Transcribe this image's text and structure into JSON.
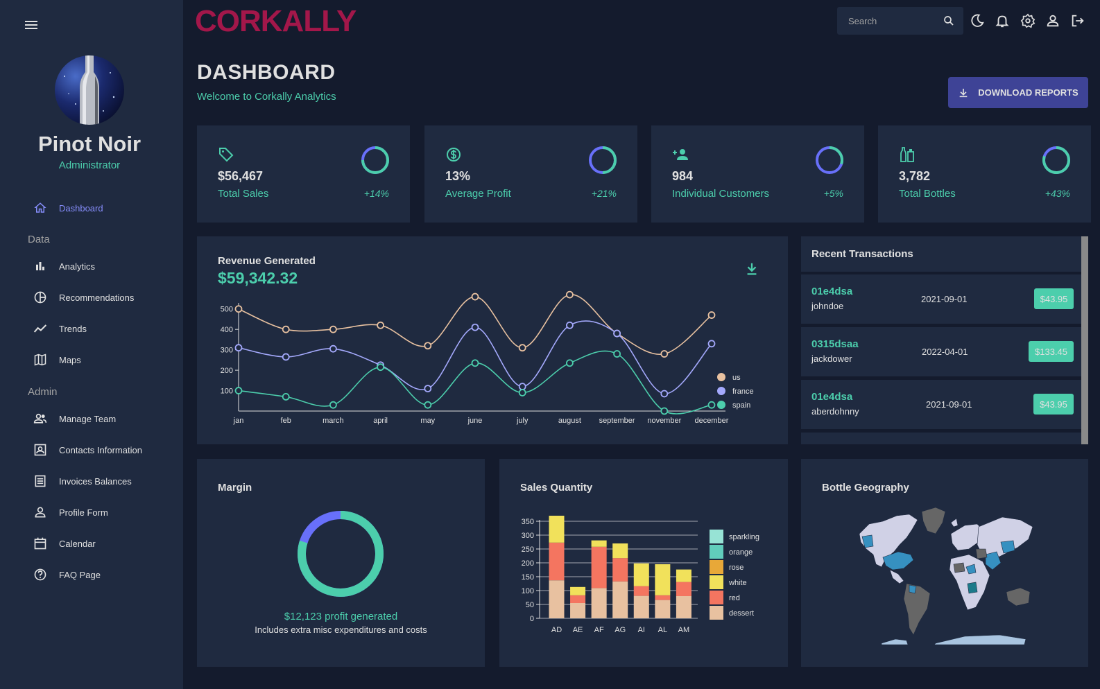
{
  "app": {
    "logo": "CORKALLY"
  },
  "sidebar": {
    "user_name": "Pinot Noir",
    "user_role": "Administrator",
    "items": [
      {
        "label": "Dashboard",
        "icon": "home-icon",
        "active": true
      },
      {
        "label": "Analytics",
        "icon": "bar-chart-icon"
      },
      {
        "label": "Recommendations",
        "icon": "pie-chart-icon"
      },
      {
        "label": "Trends",
        "icon": "timeline-icon"
      },
      {
        "label": "Maps",
        "icon": "map-icon"
      },
      {
        "label": "Manage Team",
        "icon": "people-icon"
      },
      {
        "label": "Contacts Information",
        "icon": "contacts-icon"
      },
      {
        "label": "Invoices Balances",
        "icon": "receipt-icon"
      },
      {
        "label": "Profile Form",
        "icon": "person-icon"
      },
      {
        "label": "Calendar",
        "icon": "calendar-icon"
      },
      {
        "label": "FAQ Page",
        "icon": "help-icon"
      }
    ],
    "sections": {
      "data": "Data",
      "admin": "Admin"
    }
  },
  "topbar": {
    "search_placeholder": "Search"
  },
  "header": {
    "title": "DASHBOARD",
    "subtitle": "Welcome to Corkally Analytics",
    "download_label": "DOWNLOAD REPORTS"
  },
  "stats": [
    {
      "value": "$56,467",
      "label": "Total Sales",
      "increase": "+14%",
      "progress": 0.75,
      "icon": "tag-icon"
    },
    {
      "value": "13%",
      "label": "Average Profit",
      "increase": "+21%",
      "progress": 0.5,
      "icon": "dollar-icon"
    },
    {
      "value": "984",
      "label": "Individual Customers",
      "increase": "+5%",
      "progress": 0.3,
      "icon": "person-add-icon"
    },
    {
      "value": "3,782",
      "label": "Total Bottles",
      "increase": "+43%",
      "progress": 0.8,
      "icon": "bottles-icon"
    }
  ],
  "revenue": {
    "title": "Revenue Generated",
    "value": "$59,342.32"
  },
  "transactions": {
    "title": "Recent Transactions",
    "rows": [
      {
        "id": "01e4dsa",
        "user": "johndoe",
        "date": "2021-09-01",
        "cost": "$43.95"
      },
      {
        "id": "0315dsaa",
        "user": "jackdower",
        "date": "2022-04-01",
        "cost": "$133.45"
      },
      {
        "id": "01e4dsa",
        "user": "aberdohnny",
        "date": "2021-09-01",
        "cost": "$43.95"
      }
    ]
  },
  "margin": {
    "title": "Margin",
    "profit_text": "$12,123 profit generated",
    "note": "Includes extra misc expenditures and costs",
    "progress": 0.8
  },
  "sales_quantity": {
    "title": "Sales Quantity"
  },
  "geography": {
    "title": "Bottle Geography"
  },
  "colors": {
    "accent_green": "#4cceac",
    "accent_blue": "#6870fa",
    "primary_bg": "#141b2d",
    "card_bg": "#1f2a40",
    "brand": "#a3174a",
    "button": "#3e4396"
  },
  "chart_data": [
    {
      "type": "line",
      "x": [
        "jan",
        "feb",
        "march",
        "april",
        "may",
        "june",
        "july",
        "august",
        "september",
        "november",
        "december"
      ],
      "ylim": [
        0,
        550
      ],
      "yticks": [
        100,
        200,
        300,
        400,
        500
      ],
      "series": [
        {
          "name": "us",
          "color": "#e8c1a0",
          "values": [
            500,
            400,
            400,
            420,
            320,
            560,
            310,
            570,
            380,
            280,
            470
          ]
        },
        {
          "name": "france",
          "color": "#a4a9fc",
          "values": [
            310,
            265,
            305,
            225,
            110,
            410,
            120,
            420,
            380,
            85,
            330
          ]
        },
        {
          "name": "spain",
          "color": "#4cceac",
          "values": [
            100,
            70,
            30,
            215,
            30,
            235,
            90,
            235,
            280,
            0,
            30
          ]
        }
      ]
    },
    {
      "type": "bar",
      "stacked": true,
      "categories": [
        "AD",
        "AE",
        "AF",
        "AG",
        "AI",
        "AL",
        "AM"
      ],
      "ylim": [
        0,
        350
      ],
      "yticks": [
        0,
        50,
        100,
        150,
        200,
        250,
        300,
        350
      ],
      "series": [
        {
          "name": "dessert",
          "color": "#e8c1a0",
          "values": [
            137,
            55,
            109,
            133,
            81,
            66,
            80
          ]
        },
        {
          "name": "red",
          "color": "#f47560",
          "values": [
            136,
            28,
            149,
            84,
            35,
            17,
            51
          ]
        },
        {
          "name": "white",
          "color": "#f1e15b",
          "values": [
            97,
            30,
            23,
            53,
            82,
            112,
            45
          ]
        },
        {
          "name": "rose",
          "color": "#e8a838",
          "values": [
            0,
            0,
            0,
            0,
            0,
            0,
            0
          ]
        },
        {
          "name": "orange",
          "color": "#61cdbb",
          "values": [
            0,
            0,
            0,
            0,
            0,
            0,
            0
          ]
        },
        {
          "name": "sparkling",
          "color": "#97e3d5",
          "values": [
            0,
            0,
            0,
            0,
            0,
            0,
            0
          ]
        }
      ],
      "legend": [
        "sparkling",
        "orange",
        "rose",
        "white",
        "red",
        "dessert"
      ]
    }
  ]
}
